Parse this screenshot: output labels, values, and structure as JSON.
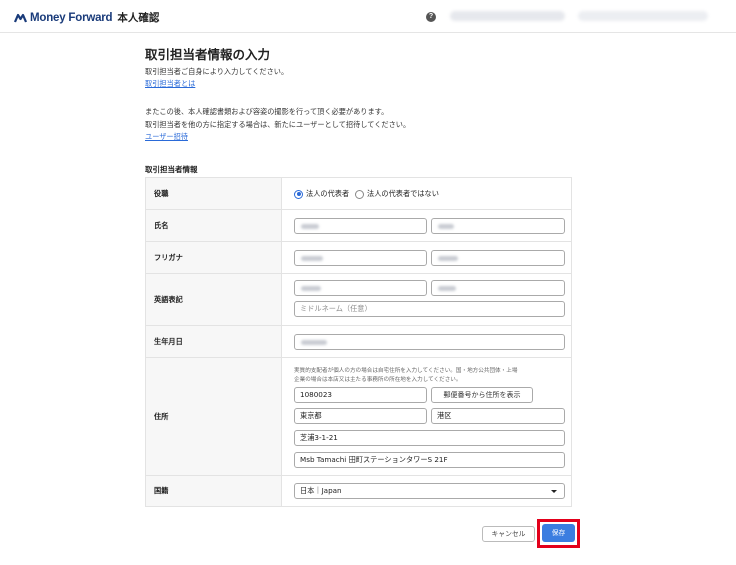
{
  "header": {
    "logo_text": "Money Forward",
    "logo_sub": "本人確認",
    "help_icon": "?"
  },
  "intro": {
    "title": "取引担当者情報の入力",
    "line1": "取引担当者ご自身により入力してください。",
    "link1": "取引担当者とは",
    "line2": "またこの後、本人確認書類および容姿の撮影を行って頂く必要があります。",
    "line3": "取引担当者を他の方に指定する場合は、新たにユーザーとして招待してください。",
    "link2": "ユーザー招待"
  },
  "section_title": "取引担当者情報",
  "form": {
    "role": {
      "label": "役職",
      "option_rep": "法人の代表者",
      "option_not_rep": "法人の代表者ではない",
      "selected": "法人の代表者"
    },
    "name": {
      "label": "氏名"
    },
    "furigana": {
      "label": "フリガナ"
    },
    "english": {
      "label": "英語表記",
      "middle_placeholder": "ミドルネーム（任意）"
    },
    "birthdate": {
      "label": "生年月日"
    },
    "address": {
      "label": "住所",
      "note1": "実質的支配者が個人の方の場合は自宅住所を入力してください。国・地方公共団体・上場",
      "note2": "企業の場合は本店又は主たる事務所の所在地を入力してください。",
      "postal_code": "1080023",
      "zip_button": "郵便番号から住所を表示",
      "prefecture": "東京都",
      "city": "港区",
      "street": "芝浦3-1-21",
      "building": "Msb Tamachi 田町ステーションタワーS 21F"
    },
    "nationality": {
      "label": "国籍",
      "value": "日本｜Japan"
    }
  },
  "buttons": {
    "cancel": "キャンセル",
    "save": "保存"
  },
  "colors": {
    "brand": "#1a3b7a",
    "link": "#2a6ad8",
    "primary_button": "#3b7de0",
    "highlight_box": "#e3001b"
  },
  "icons": {
    "help": "help-icon",
    "logo": "money-forward-logo",
    "select_caret": "caret-down-icon"
  }
}
